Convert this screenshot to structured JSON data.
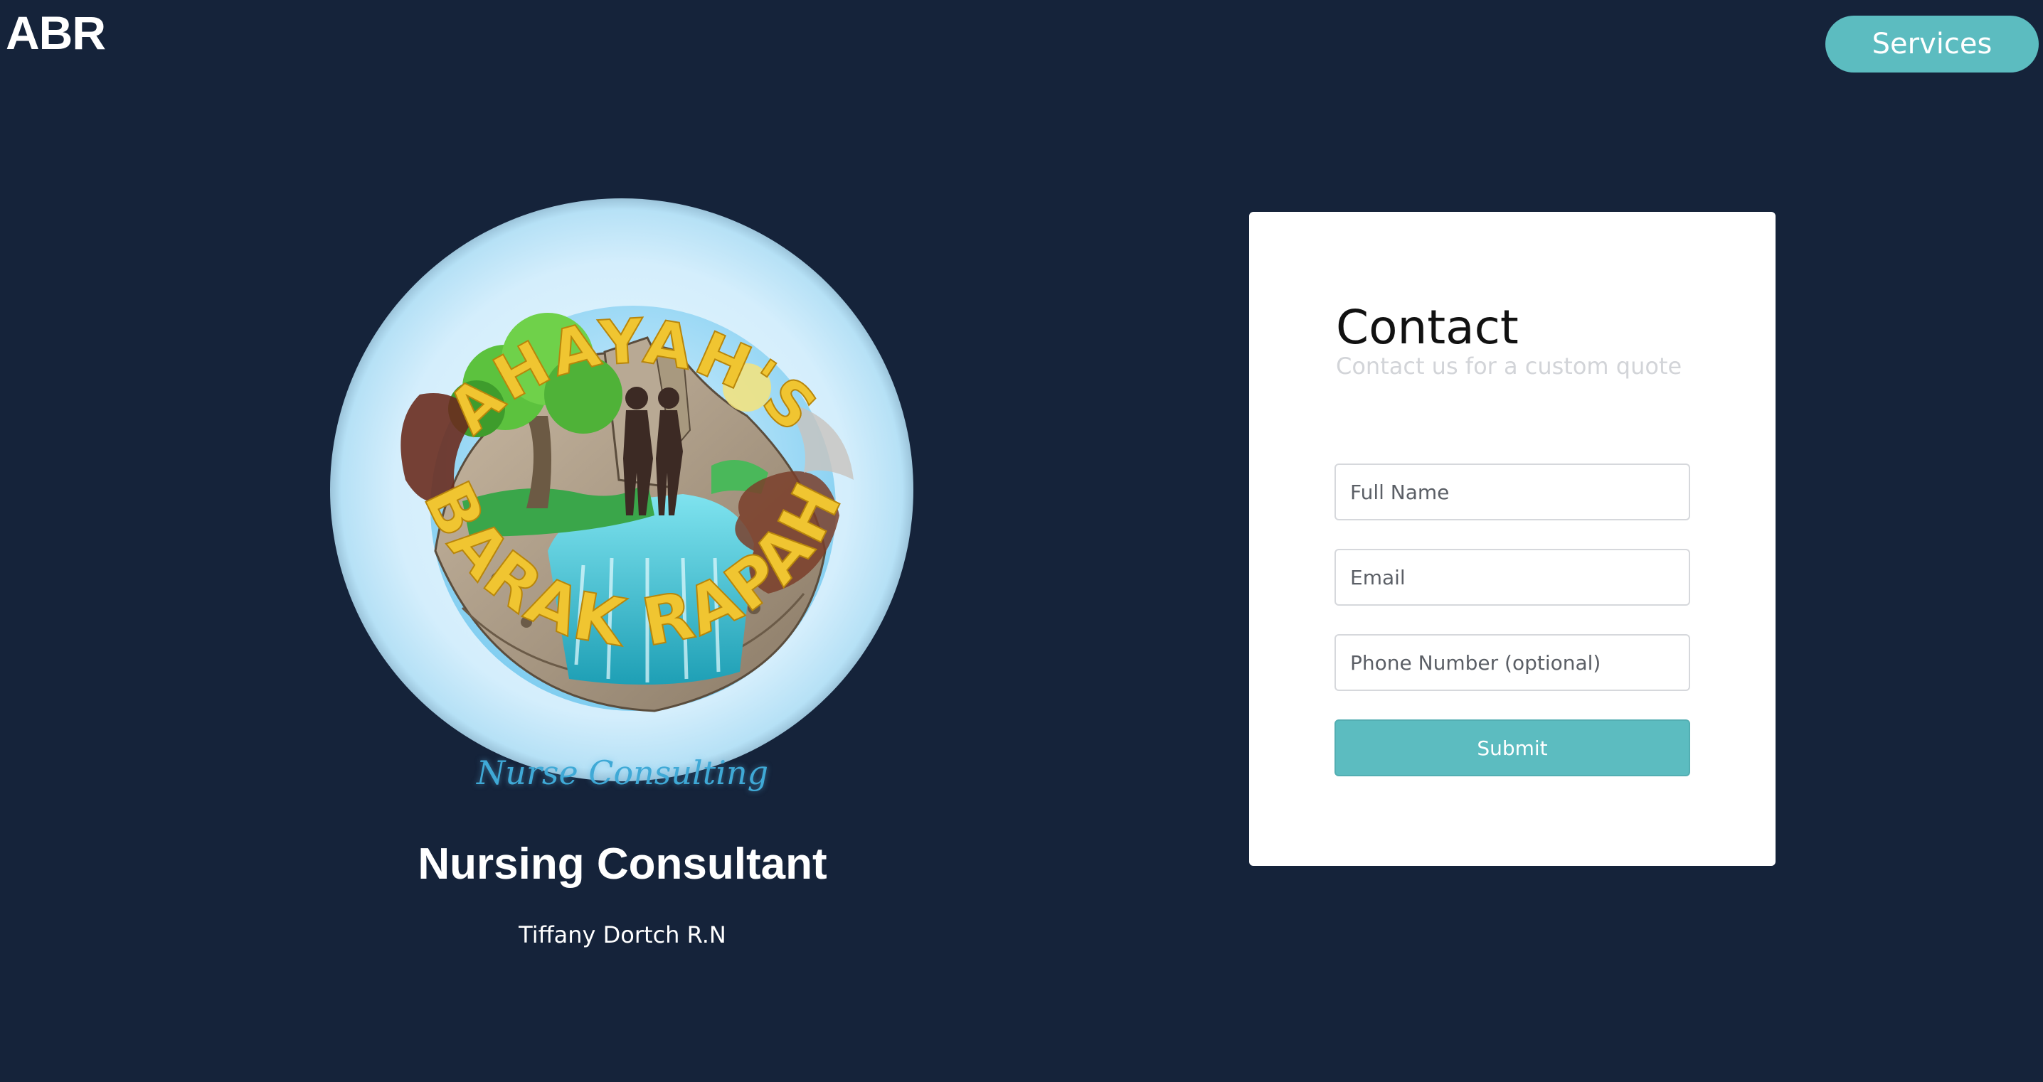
{
  "header": {
    "brand": "ABR",
    "services_label": "Services"
  },
  "hero": {
    "logo": {
      "top_text": "AHAYAH'S",
      "bottom_text": "BARAK RAPAH",
      "tagline": "Nurse Consulting"
    },
    "title": "Nursing Consultant",
    "subtitle": "Tiffany Dortch R.N"
  },
  "contact": {
    "title": "Contact",
    "subtitle": "Contact us for a custom quote",
    "fields": {
      "full_name_placeholder": "Full Name",
      "email_placeholder": "Email",
      "phone_placeholder": "Phone Number (optional)"
    },
    "submit_label": "Submit"
  },
  "colors": {
    "background": "#15233a",
    "accent": "#5cbcc0",
    "logo_gold": "#e9b828",
    "card": "#ffffff"
  },
  "icons": {
    "logo": "globe-logo-icon"
  }
}
